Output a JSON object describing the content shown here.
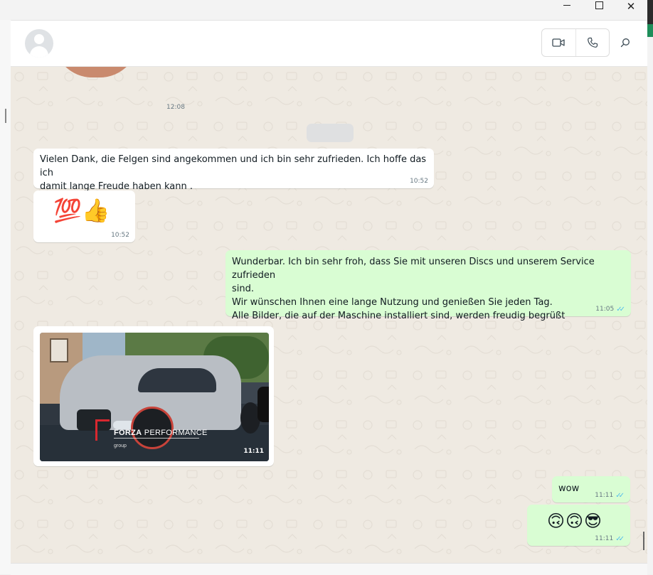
{
  "window": {
    "controls": [
      "minimize",
      "maximize",
      "close"
    ],
    "close_glyph": "✕"
  },
  "header": {
    "avatar_icon": "default-avatar-icon",
    "video_icon": "video-camera-icon",
    "phone_icon": "phone-icon",
    "search_icon": "search-icon"
  },
  "chat": {
    "sticker_time": "12:08",
    "messages": [
      {
        "direction": "incoming",
        "text": "Vielen Dank, die Felgen sind angekommen und ich bin sehr zufrieden. Ich hoffe das ich\ndamit lange Freude haben kann .",
        "time": "10:52"
      },
      {
        "direction": "incoming",
        "emoji": "💯👍",
        "time": "10:52"
      },
      {
        "direction": "outgoing",
        "text": "Wunderbar. Ich bin sehr froh, dass Sie mit unseren Discs und unserem Service zufrieden\nsind.\nWir wünschen Ihnen eine lange Nutzung und genießen Sie jeden Tag.\nAlle Bilder, die auf der Maschine installiert sind, werden freudig begrüßt",
        "time": "11:05",
        "status": "read"
      },
      {
        "direction": "incoming",
        "type": "image",
        "image_logo_brand": "FORZA",
        "image_logo_suffix": " PERFORMANCE",
        "image_logo_sub": "group",
        "time": "11:11"
      },
      {
        "direction": "outgoing",
        "text": "wow",
        "time": "11:11",
        "status": "read"
      },
      {
        "direction": "outgoing",
        "emoji": "🙃🙃😎",
        "time": "11:11",
        "status": "read"
      }
    ],
    "read_ticks": "✓✓"
  },
  "colors": {
    "incoming_bubble": "#ffffff",
    "outgoing_bubble": "#d9fdd3",
    "read_tick": "#53bdeb",
    "chat_background": "#efeae2"
  }
}
